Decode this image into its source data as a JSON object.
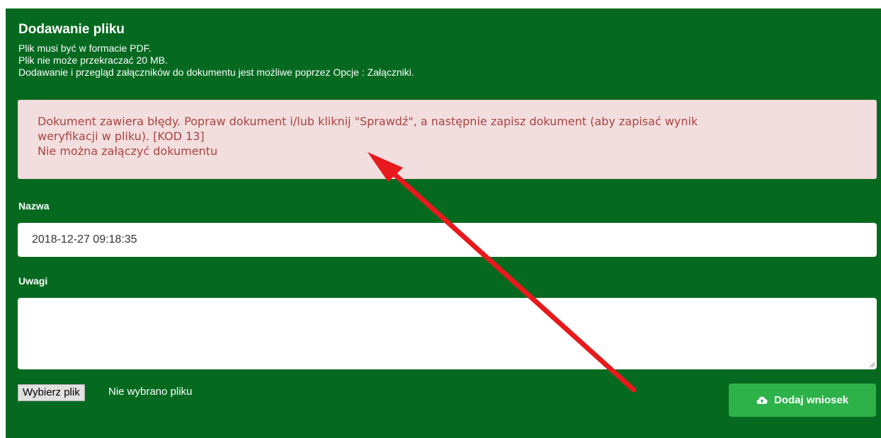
{
  "header": {
    "title": "Dodawanie pliku",
    "notes": [
      "Plik musi być w formacie PDF.",
      "Plik nie może przekraczać 20 MB.",
      "Dodawanie i przegląd załączników do dokumentu jest możliwe poprzez Opcje : Załączniki."
    ]
  },
  "alert": {
    "lines": [
      "Dokument zawiera błędy. Popraw dokument i/lub kliknij \"Sprawdź\", a następnie zapisz dokument (aby zapisać wynik",
      "weryfikacji w pliku). [KOD 13]",
      "Nie można załączyć dokumentu"
    ]
  },
  "form": {
    "name_label": "Nazwa",
    "name_value": "2018-12-27 09:18:35",
    "remarks_label": "Uwagi",
    "remarks_value": "",
    "file_button_label": "Wybierz plik",
    "file_status": "Nie wybrano pliku",
    "submit_label": "Dodaj wniosek",
    "submit_icon": "cloud-upload-icon"
  },
  "colors": {
    "panel_bg": "#056a1f",
    "alert_bg": "#f2dede",
    "alert_text": "#a94442",
    "submit_bg": "#2db24a",
    "annotation_arrow": "#e8191c"
  }
}
